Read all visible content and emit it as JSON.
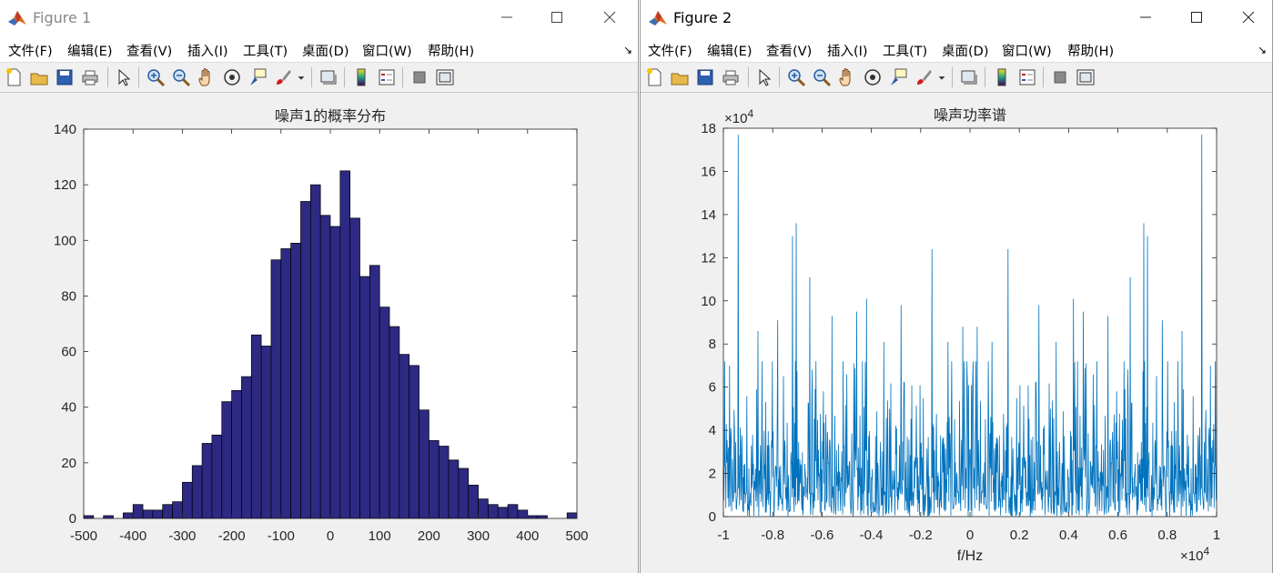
{
  "windows": [
    {
      "title": "Figure 1",
      "menus": [
        "文件(F)",
        "编辑(E)",
        "查看(V)",
        "插入(I)",
        "工具(T)",
        "桌面(D)",
        "窗口(W)",
        "帮助(H)"
      ]
    },
    {
      "title": "Figure 2",
      "menus": [
        "文件(F)",
        "编辑(E)",
        "查看(V)",
        "插入(I)",
        "工具(T)",
        "桌面(D)",
        "窗口(W)",
        "帮助(H)"
      ]
    }
  ],
  "toolbar_icons": [
    "new-figure-icon",
    "open-file-icon",
    "save-icon",
    "print-icon",
    "pointer-icon",
    "zoom-in-icon",
    "zoom-out-icon",
    "pan-hand-icon",
    "rotate-3d-icon",
    "data-cursor-icon",
    "brush-icon",
    "brush-dropdown-icon",
    "link-plot-icon",
    "colorbar-icon",
    "legend-icon",
    "hide-plot-tools-icon",
    "show-plot-tools-icon"
  ],
  "colors": {
    "histogram_fill": "#2e2982",
    "spectrum_line": "#0072bd",
    "axes_bg": "#ffffff",
    "figure_bg": "#f0f0f0"
  },
  "chart_data": [
    {
      "type": "bar",
      "title": "噪声1的概率分布",
      "xlabel": "",
      "ylabel": "",
      "xlim": [
        -500,
        500
      ],
      "ylim": [
        0,
        140
      ],
      "xticks": [
        -500,
        -400,
        -300,
        -200,
        -100,
        0,
        100,
        200,
        300,
        400,
        500
      ],
      "yticks": [
        0,
        20,
        40,
        60,
        80,
        100,
        120,
        140
      ],
      "bin_width": 20,
      "bin_start": -500,
      "values": [
        1,
        0,
        1,
        0,
        2,
        5,
        3,
        3,
        5,
        6,
        13,
        19,
        27,
        30,
        42,
        46,
        51,
        66,
        62,
        93,
        97,
        99,
        114,
        120,
        109,
        105,
        125,
        108,
        87,
        91,
        76,
        69,
        59,
        55,
        39,
        28,
        26,
        21,
        18,
        12,
        7,
        5,
        4,
        5,
        3,
        1,
        1,
        0,
        0,
        2
      ]
    },
    {
      "type": "line",
      "title": "噪声功率谱",
      "xlabel": "f/Hz",
      "ylabel": "",
      "xlim": [
        -1,
        1
      ],
      "ylim": [
        0,
        18
      ],
      "x_exponent": "×10^4",
      "y_exponent": "×10^4",
      "xticks": [
        -1,
        -0.8,
        -0.6,
        -0.4,
        -0.2,
        0,
        0.2,
        0.4,
        0.6,
        0.8,
        1
      ],
      "yticks": [
        0,
        2,
        4,
        6,
        8,
        10,
        12,
        14,
        16,
        18
      ],
      "samples": 1200,
      "peaks": [
        [
          -0.94,
          17.7
        ],
        [
          0.94,
          17.7
        ],
        [
          -0.705,
          13.6
        ],
        [
          0.705,
          13.6
        ],
        [
          -0.72,
          13.0
        ],
        [
          0.72,
          13.0
        ],
        [
          -0.65,
          11.1
        ],
        [
          0.65,
          11.1
        ],
        [
          -0.155,
          12.4
        ],
        [
          0.155,
          12.4
        ],
        [
          -0.42,
          10.1
        ],
        [
          0.42,
          10.1
        ],
        [
          -0.78,
          9.1
        ],
        [
          0.78,
          9.1
        ],
        [
          -0.56,
          9.3
        ],
        [
          0.56,
          9.3
        ],
        [
          -0.46,
          9.5
        ],
        [
          0.46,
          9.5
        ],
        [
          -0.28,
          9.8
        ],
        [
          0.28,
          9.8
        ],
        [
          -0.03,
          8.8
        ],
        [
          0.03,
          8.8
        ],
        [
          -0.86,
          8.6
        ],
        [
          0.86,
          8.6
        ],
        [
          -0.35,
          8.1
        ],
        [
          0.35,
          8.1
        ],
        [
          -0.09,
          8.1
        ],
        [
          0.09,
          8.1
        ],
        [
          -0.975,
          7.0
        ],
        [
          0.975,
          7.0
        ]
      ]
    }
  ]
}
